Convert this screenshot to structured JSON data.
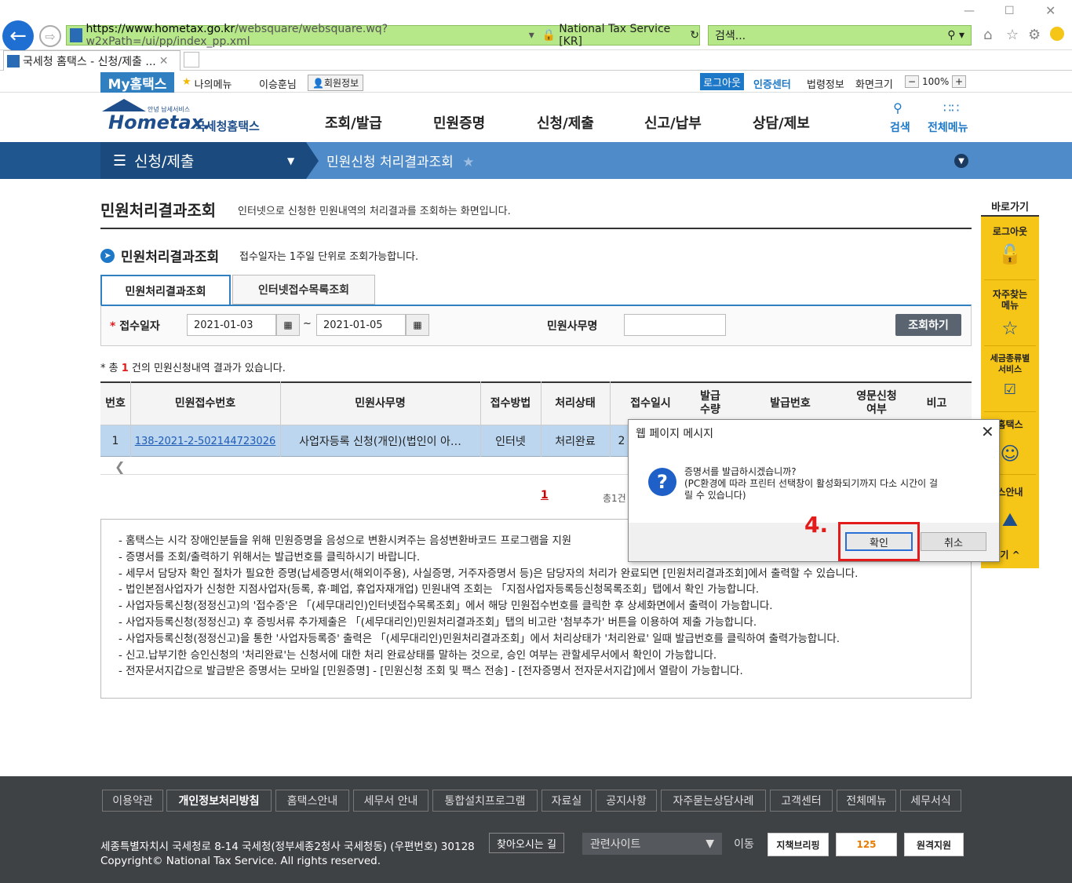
{
  "browser": {
    "url_prefix": "https://www.hometax.go.kr",
    "url_path": "/websquare/websquare.wq?w2xPath=/ui/pp/index_pp.xml",
    "site_identity": "National Tax Service [KR]",
    "search_placeholder": "검색...",
    "tab_title": "국세청 홈택스 - 신청/제출 ..."
  },
  "topbar": {
    "my_hometax": "My홈택스",
    "my_menu": "나의메뉴",
    "user_name": "이승훈님",
    "member_info": "회원정보",
    "logout": "로그아웃",
    "cert_center": "인증센터",
    "law_info": "법령정보",
    "screen_size": "화면크기",
    "zoom": "100%"
  },
  "header": {
    "logo_small": "안녕 납세서비스",
    "logo_main": "Hometax.",
    "logo_korean": "국세청홈택스",
    "gnb": [
      "조회/발급",
      "민원증명",
      "신청/제출",
      "신고/납부",
      "상담/제보"
    ],
    "search": "검색",
    "all_menu": "전체메뉴"
  },
  "navbar": {
    "section": "신청/제출",
    "crumb": "민원신청 처리결과조회"
  },
  "content": {
    "page_title": "민원처리결과조회",
    "page_desc": "인터넷으로 신청한 민원내역의 처리결과를 조회하는 화면입니다.",
    "sec_title": "민원처리결과조회",
    "sec_desc": "접수일자는 1주일 단위로 조회가능합니다.",
    "tabs": [
      "민원처리결과조회",
      "인터넷접수목록조회"
    ],
    "date_label": "접수일자",
    "date_from": "2021-01-03",
    "date_to": "2021-01-05",
    "tilde": "~",
    "svc_label": "민원사무명",
    "query_btn": "조회하기",
    "result_prefix": "* 총",
    "result_count": "1",
    "result_suffix": "건의 민원신청내역 결과가 있습니다.",
    "page_num": "1",
    "total_label": "총1건"
  },
  "table": {
    "headers": [
      "번호",
      "민원접수번호",
      "민원사무명",
      "접수방법",
      "처리상태",
      "접수일시",
      "발급\n수량",
      "발급번호",
      "영문신청\n여부",
      "비고"
    ],
    "row": {
      "no": "1",
      "receipt": "138-2021-2-502144723026",
      "service": "사업자등록 신청(개인)(법인이 아…",
      "method": "인터넷",
      "status": "처리완료",
      "date_partial": "2"
    }
  },
  "notes": [
    "- 홈택스는 시각 장애인분들을 위해 민원증명을 음성으로 변환시켜주는 음성변환바코드 프로그램을 지원",
    "- 증명서를 조회/출력하기 위해서는 발급번호를 클릭하시기 바랍니다.",
    "- 세무서 담당자 확인 절차가 필요한 증명(납세증명서(해외이주용), 사실증명, 거주자증명서 등)은 담당자의 처리가 완료되면 [민원처리결과조회]에서 출력할 수 있습니다.",
    "- 법인본점사업자가 신청한 지점사업자(등록, 휴·폐업, 휴업자재개업) 민원내역 조회는 「지점사업자등록등신청목록조회」탭에서 확인 가능합니다.",
    "- 사업자등록신청(정정신고)의 '접수증'은 「(세무대리인)인터넷접수목록조회」에서 해당 민원접수번호를 클릭한 후 상세화면에서 출력이 가능합니다.",
    "- 사업자등록신청(정정신고) 후 증빙서류 추가제출은 「(세무대리인)민원처리결과조회」탭의 비고란 '첨부추가' 버튼을 이용하여 제출 가능합니다.",
    "- 사업자등록신청(정정신고)을 통한 '사업자등록증' 출력은 「(세무대리인)민원처리결과조회」에서 처리상태가 '처리완료' 일때 발급번호를 클릭하여 출력가능합니다.",
    "- 신고.납부기한 승인신청의 '처리완료'는 신청서에 대한 처리 완료상태를 말하는 것으로, 승인 여부는 관할세무서에서 확인이 가능합니다.",
    "- 전자문서지갑으로 발급받은 증명서는 모바일 [민원증명] - [민원신청 조회 및 팩스 전송] - [전자증명서 전자문서지갑]에서 열람이 가능합니다."
  ],
  "quick": {
    "title": "바로가기",
    "items": [
      "로그아웃",
      "자주찾는\n메뉴",
      "세금종류별\n서비스",
      "홈택스",
      "스안내",
      "기 ^"
    ]
  },
  "dialog": {
    "title": "웹 페이지 메시지",
    "line1": "증명서를 발급하시겠습니까?",
    "line2": "(PC환경에 따라 프린터 선택창이 활성화되기까지 다소 시간이 걸",
    "line3": "릴 수 있습니다)",
    "ok": "확인",
    "cancel": "취소",
    "step": "4."
  },
  "footer": {
    "links": [
      "이용약관",
      "개인정보처리방침",
      "홈택스안내",
      "세무서 안내",
      "통합설치프로그램",
      "자료실",
      "공지사항",
      "자주묻는상담사례",
      "고객센터",
      "전체메뉴",
      "세무서식"
    ],
    "address": "세종특별자치시 국세청로 8-14 국세청(정부세종2청사 국세청동) (우편번호) 30128",
    "findway": "찾아오시는 길",
    "copyright": "Copyright© National Tax Service. All rights reserved.",
    "related": "관련사이트",
    "move": "이동",
    "badge1": "지책브리핑",
    "badge2": "125",
    "badge3": "원격지원"
  },
  "colors": {
    "nav_dark": "#1b4b7e",
    "nav_light": "#4f8bc8",
    "accent": "#2f7fc1",
    "quick_yellow": "#f5c518",
    "highlight": "#e31b1b"
  }
}
